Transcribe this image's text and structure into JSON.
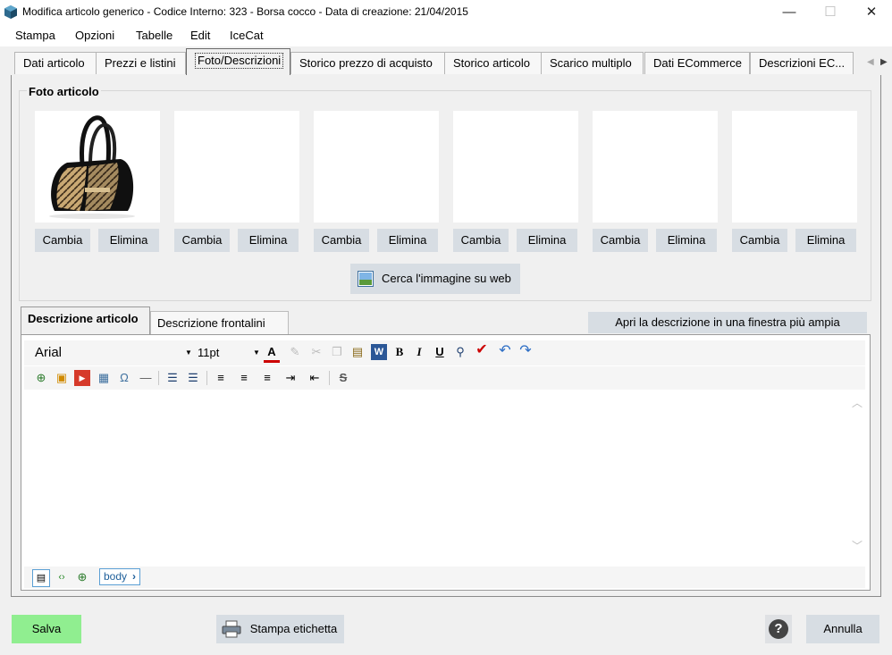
{
  "window": {
    "title": "Modifica articolo generico - Codice Interno: 323 - Borsa cocco - Data di creazione: 21/04/2015",
    "minimize": "—",
    "maximize": "☐",
    "close": "✕"
  },
  "menu": [
    "Stampa",
    "Opzioni",
    "Tabelle",
    "Edit",
    "IceCat"
  ],
  "tabs": [
    {
      "label": "Dati articolo",
      "active": false
    },
    {
      "label": "Prezzi e listini",
      "active": false
    },
    {
      "label": "Foto/Descrizioni",
      "active": true
    },
    {
      "label": "Storico prezzo di acquisto",
      "active": false
    },
    {
      "label": "Storico articolo",
      "active": false
    },
    {
      "label": "Scarico multiplo",
      "active": false
    },
    {
      "label": "Dati ECommerce",
      "active": false
    },
    {
      "label": "Descrizioni  EC...",
      "active": false
    }
  ],
  "photos": {
    "group_title": "Foto articolo",
    "change_label": "Cambia",
    "delete_label": "Elimina",
    "search_web_label": "Cerca l'immagine su web"
  },
  "description": {
    "subtabs": [
      {
        "label": "Descrizione articolo",
        "active": true
      },
      {
        "label": "Descrizione frontalini",
        "active": false
      }
    ],
    "open_wider_label": "Apri la descrizione in una finestra più ampia",
    "font_family": "Arial",
    "font_size": "11pt",
    "breadcrumb": "body"
  },
  "footer": {
    "save_label": "Salva",
    "print_label_label": "Stampa etichetta",
    "help_label": "?",
    "cancel_label": "Annulla"
  },
  "colors": {
    "save_button": "#90ee90",
    "button": "#d7dde3",
    "help_button": "#dfe1e4"
  }
}
